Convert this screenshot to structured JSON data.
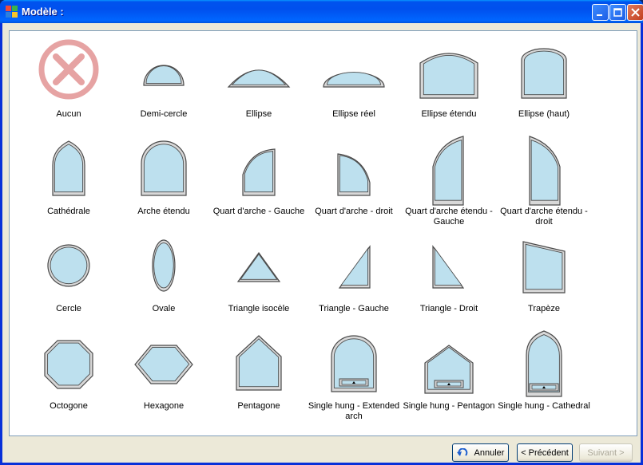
{
  "window": {
    "title": "Modèle :"
  },
  "shapes": [
    {
      "label": "Aucun",
      "icon": "none-icon"
    },
    {
      "label": "Demi-cercle",
      "icon": "half-circle-window-icon"
    },
    {
      "label": "Ellipse",
      "icon": "ellipse-window-icon"
    },
    {
      "label": "Ellipse réel",
      "icon": "real-ellipse-window-icon"
    },
    {
      "label": "Ellipse étendu",
      "icon": "extended-ellipse-window-icon"
    },
    {
      "label": "Ellipse (haut)",
      "icon": "ellipse-top-window-icon"
    },
    {
      "label": "Cathédrale",
      "icon": "cathedral-window-icon"
    },
    {
      "label": "Arche étendu",
      "icon": "extended-arch-window-icon"
    },
    {
      "label": "Quart d'arche - Gauche",
      "icon": "quarter-arch-left-window-icon"
    },
    {
      "label": "Quart d'arche - droit",
      "icon": "quarter-arch-right-window-icon"
    },
    {
      "label": "Quart d'arche étendu - Gauche",
      "icon": "extended-quarter-arch-left-window-icon"
    },
    {
      "label": "Quart d'arche étendu - droit",
      "icon": "extended-quarter-arch-right-window-icon"
    },
    {
      "label": "Cercle",
      "icon": "circle-window-icon"
    },
    {
      "label": "Ovale",
      "icon": "oval-window-icon"
    },
    {
      "label": "Triangle isocèle",
      "icon": "isosceles-triangle-window-icon"
    },
    {
      "label": "Triangle - Gauche",
      "icon": "triangle-left-window-icon"
    },
    {
      "label": "Triangle - Droit",
      "icon": "triangle-right-window-icon"
    },
    {
      "label": "Trapèze",
      "icon": "trapezoid-window-icon"
    },
    {
      "label": "Octogone",
      "icon": "octagon-window-icon"
    },
    {
      "label": "Hexagone",
      "icon": "hexagon-window-icon"
    },
    {
      "label": "Pentagone",
      "icon": "pentagon-window-icon"
    },
    {
      "label": "Single hung - Extended arch",
      "icon": "single-hung-extended-arch-icon"
    },
    {
      "label": "Single hung - Pentagon",
      "icon": "single-hung-pentagon-icon"
    },
    {
      "label": "Single hung - Cathedral",
      "icon": "single-hung-cathedral-icon"
    }
  ],
  "buttons": {
    "cancel": "Annuler",
    "previous": "< Précédent",
    "next": "Suivant >"
  },
  "colors": {
    "glass": "#bde0ee",
    "frame": "#d8d8d8",
    "outline": "#4a4a4a",
    "titlebar": "#0054e3"
  }
}
